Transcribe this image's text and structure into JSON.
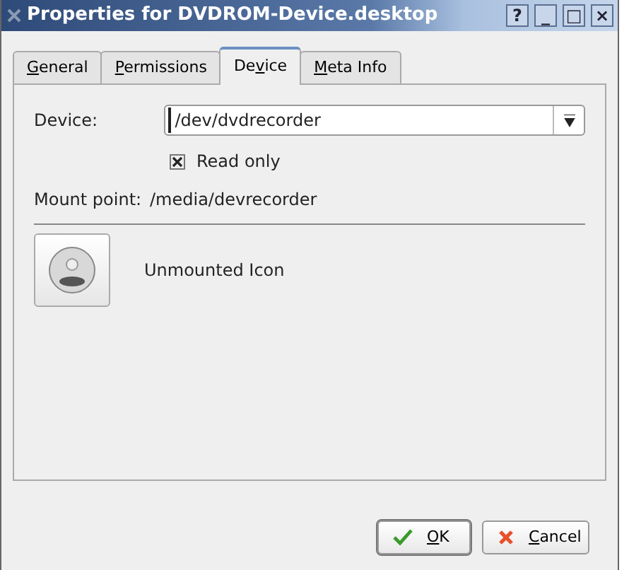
{
  "window": {
    "title": "Properties for DVDROM-Device.desktop",
    "controls": [
      "?",
      "_",
      "□",
      "×"
    ]
  },
  "tabs": [
    {
      "label": {
        "key": "G",
        "post": "eneral"
      },
      "selected": false
    },
    {
      "label": {
        "key": "P",
        "post": "ermissions"
      },
      "selected": false
    },
    {
      "label": {
        "pre": "De",
        "key": "v",
        "post": "ice"
      },
      "selected": true
    },
    {
      "label": {
        "key": "M",
        "post": "eta Info"
      },
      "selected": false
    }
  ],
  "device": {
    "label": "Device:",
    "value": "/dev/dvdrecorder"
  },
  "read_only": {
    "label": "Read only",
    "checked": true
  },
  "mount_point": {
    "label": "Mount point:",
    "value": "/media/devrecorder"
  },
  "icon": {
    "label": "Unmounted Icon"
  },
  "buttons": [
    {
      "kind": "ok",
      "label": {
        "key": "O",
        "post": "K"
      }
    },
    {
      "kind": "cancel",
      "label": {
        "key": "C",
        "post": "ancel"
      }
    }
  ]
}
